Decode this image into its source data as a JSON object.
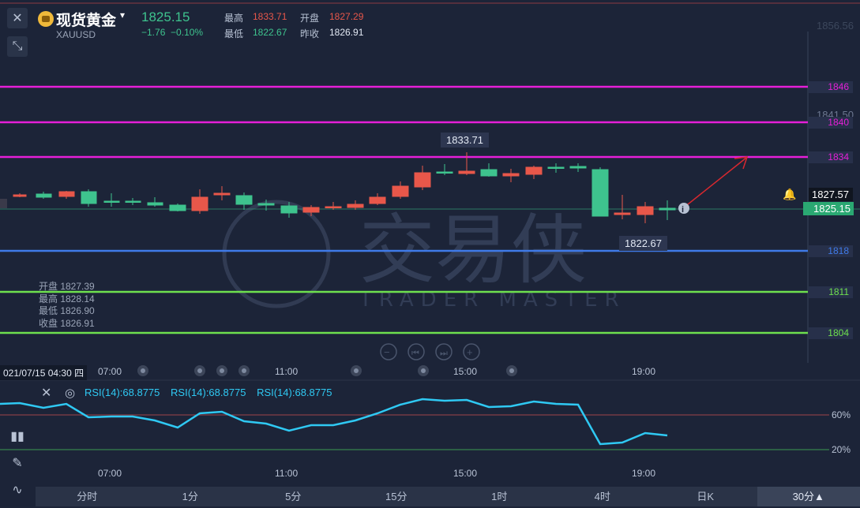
{
  "header": {
    "name": "现货黄金",
    "code": "XAUUSD",
    "price": "1825.15",
    "change": "−1.76",
    "change_pct": "−0.10%",
    "high_label": "最高",
    "high": "1833.71",
    "open_label": "开盘",
    "open": "1827.29",
    "low_label": "最低",
    "low": "1822.67",
    "prev_label": "昨收",
    "prev": "1826.91"
  },
  "axis": {
    "top_label": "1856.56",
    "mid_label": "1841.50",
    "last_price": "1827.57",
    "current_price": "1825.15"
  },
  "levels": [
    {
      "value": "1846",
      "color": "#e61fd8"
    },
    {
      "value": "1840",
      "color": "#e61fd8"
    },
    {
      "value": "1834",
      "color": "#e61fd8"
    },
    {
      "value": "1818",
      "color": "#3f7ae8"
    },
    {
      "value": "1811",
      "color": "#6ee04e"
    },
    {
      "value": "1804",
      "color": "#6ee04e"
    }
  ],
  "annotations": {
    "high_callout": "1833.71",
    "low_callout": "1822.67"
  },
  "ohlc_overlay": {
    "open": "开盘 1827.39",
    "high": "最高 1828.14",
    "low": "最低 1826.90",
    "close": "收盘 1826.91"
  },
  "time_axis": {
    "cursor_date": "021/07/15 04:30 四",
    "ticks": [
      "07:00",
      "11:00",
      "15:00",
      "19:00"
    ]
  },
  "watermark": {
    "cn": "交易侠",
    "en": "TRADER MASTER"
  },
  "rsi": {
    "labels": [
      "RSI(14):68.8775",
      "RSI(14):68.8775",
      "RSI(14):68.8775"
    ],
    "levels": [
      "60%",
      "20%"
    ]
  },
  "tabs": [
    "分时",
    "1分",
    "5分",
    "15分",
    "1时",
    "4时",
    "日K",
    "30分▲"
  ],
  "colors": {
    "up": "#e8574a",
    "down": "#3ec38e",
    "rsi": "#2fc9f3",
    "background": "#1c2438"
  }
}
